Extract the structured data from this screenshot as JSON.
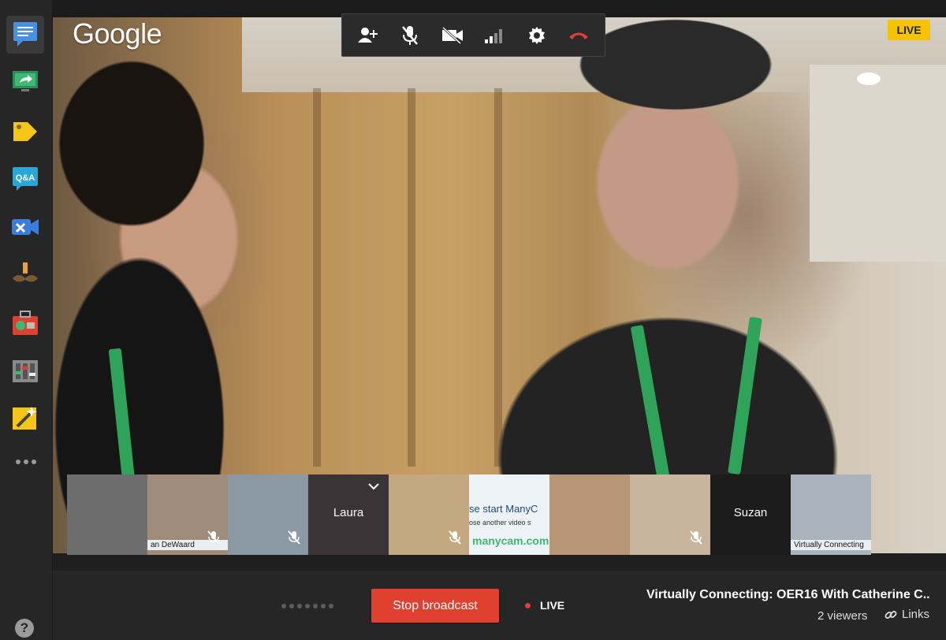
{
  "app": {
    "brand_logo": "Google",
    "live_badge": "LIVE"
  },
  "rail": {
    "items": [
      {
        "name": "chat-icon",
        "active": true
      },
      {
        "name": "screenshare-icon"
      },
      {
        "name": "label-tag-icon"
      },
      {
        "name": "qa-icon"
      },
      {
        "name": "control-room-icon"
      },
      {
        "name": "effects-mustache-icon"
      },
      {
        "name": "toolbox-icon"
      },
      {
        "name": "cameraman-icon"
      },
      {
        "name": "magic-wand-icon"
      }
    ],
    "more_icon": "more-horizontal-icon",
    "help_label": "?"
  },
  "toolbar": {
    "buttons": [
      {
        "name": "add-people-icon"
      },
      {
        "name": "mute-microphone-icon"
      },
      {
        "name": "camera-off-icon"
      },
      {
        "name": "bandwidth-icon"
      },
      {
        "name": "settings-icon"
      },
      {
        "name": "hang-up-icon"
      }
    ]
  },
  "filmstrip": {
    "participants": [
      {
        "label": "",
        "muted": false,
        "bg": "#6d6d6d",
        "caption": ""
      },
      {
        "label": "",
        "muted": true,
        "bg": "#9f8c7b",
        "caption": "an DeWaard"
      },
      {
        "label": "",
        "muted": true,
        "bg": "#8a99a3",
        "caption": ""
      },
      {
        "label": "Laura",
        "muted": false,
        "bg": "#3a3436",
        "caption": ""
      },
      {
        "label": "",
        "muted": true,
        "bg": "#c4a882",
        "caption": ""
      },
      {
        "label": "",
        "muted": false,
        "bg": "#eef3f7",
        "caption": "",
        "text_top": "se start ManyC",
        "text_mid": "ose another video s",
        "text_bottom": "manycam.com"
      },
      {
        "label": "",
        "muted": false,
        "bg": "#b79678",
        "caption": ""
      },
      {
        "label": "",
        "muted": true,
        "bg": "#c9b59e",
        "caption": ""
      },
      {
        "label": "Suzan",
        "muted": false,
        "bg": "#1c1c1c",
        "caption": ""
      },
      {
        "label": "",
        "muted": false,
        "bg": "#aab3bb",
        "caption": "Virtually Connecting"
      }
    ]
  },
  "bottom": {
    "stop_label": "Stop broadcast",
    "live_label": "LIVE",
    "event_title": "Virtually Connecting: OER16 With Catherine C...",
    "viewers": "2 viewers",
    "links_label": "Links"
  },
  "colors": {
    "accent_red": "#e0402f",
    "live_yellow": "#f7c300"
  }
}
